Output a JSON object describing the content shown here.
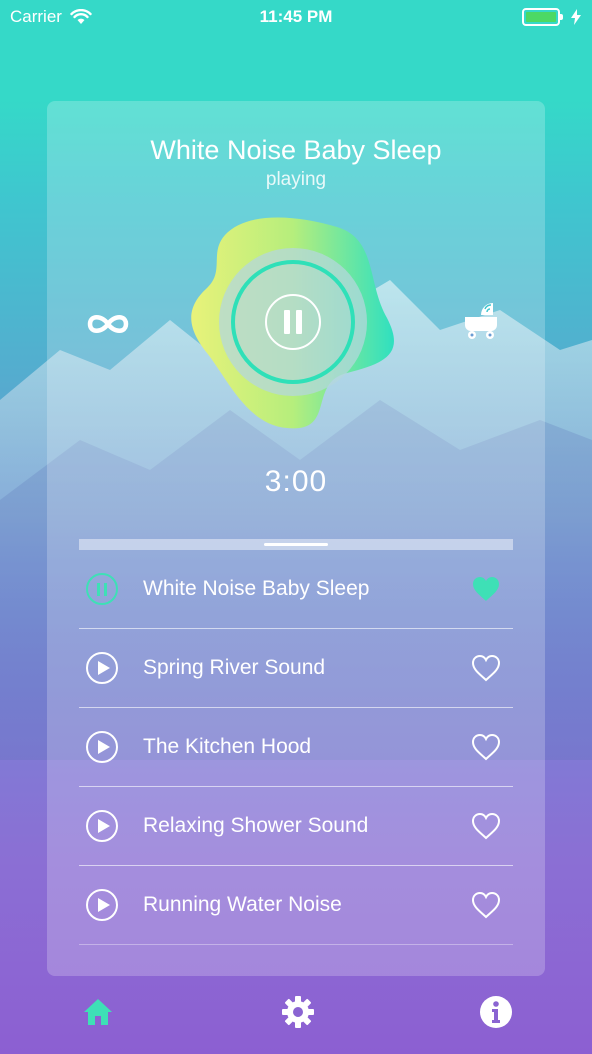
{
  "status_bar": {
    "carrier": "Carrier",
    "time": "11:45 PM"
  },
  "player": {
    "title": "White Noise Baby Sleep",
    "status": "playing",
    "timer": "3:00",
    "progress": 0.5,
    "accent_color": "#3ee0b6"
  },
  "tracks": [
    {
      "label": "White Noise Baby Sleep",
      "playing": true,
      "favorite": true
    },
    {
      "label": "Spring River Sound",
      "playing": false,
      "favorite": false
    },
    {
      "label": "The Kitchen Hood",
      "playing": false,
      "favorite": false
    },
    {
      "label": "Relaxing Shower Sound",
      "playing": false,
      "favorite": false
    },
    {
      "label": "Running Water Noise",
      "playing": false,
      "favorite": false
    }
  ],
  "tabs": [
    {
      "icon": "home-icon",
      "active": true
    },
    {
      "icon": "gear-icon",
      "active": false
    },
    {
      "icon": "info-icon",
      "active": false
    }
  ],
  "colors": {
    "teal": "#35d9c8",
    "purple": "#8c5fd2",
    "heart_active": "#3ee0b6"
  }
}
